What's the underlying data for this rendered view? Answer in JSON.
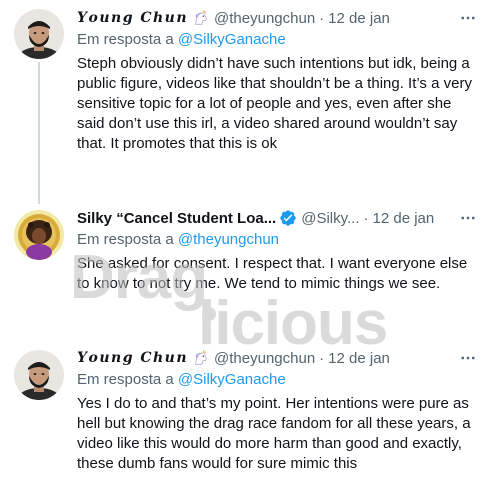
{
  "tweets": [
    {
      "display_name": "𝒀𝒐𝒖𝒏𝒈 𝑪𝒉𝒖𝒏",
      "emoji": "unicorn-emoji",
      "handle": "@theyungchun",
      "separator": "·",
      "time": "12 de jan",
      "reply_prefix": "Em resposta a",
      "reply_mention": "@SilkyGanache",
      "text": "Steph obviously didn’t have such intentions but idk, being a public figure, videos like that shouldn’t be a thing. It’s a very sensitive topic for a lot of people and yes, even after she said don’t use this irl, a video shared around wouldn’t say that. It promotes that this is ok"
    },
    {
      "display_name": "Silky “Cancel Student Loa...",
      "verified": "verified-badge-icon",
      "handle": "@Silky...",
      "separator": "·",
      "time": "12 de jan",
      "reply_prefix": "Em resposta a",
      "reply_mention": "@theyungchun",
      "text": "She asked for consent. I respect that. I want everyone else to know to not try me. We tend to mimic things we see."
    },
    {
      "display_name": "𝒀𝒐𝒖𝒏𝒈 𝑪𝒉𝒖𝒏",
      "emoji": "unicorn-emoji",
      "handle": "@theyungchun",
      "separator": "·",
      "time": "12 de jan",
      "reply_prefix": "Em resposta a",
      "reply_mention": "@SilkyGanache",
      "text": "Yes I do to and that’s my point. Her intentions were pure as hell but knowing the drag race fandom for all these years, a video like this would do more harm than good and exactly, these dumb fans would for sure mimic this"
    }
  ],
  "watermark": "Dragilicious",
  "colors": {
    "link": "#1d9bf0",
    "secondary_text": "#536471",
    "primary_text": "#0f1419",
    "thread_line": "#cfd9de",
    "verified": "#1d9bf0",
    "watermark": "#c8c8c8"
  },
  "icons": {
    "more": "more-horizontal-icon",
    "verified": "verified-badge-icon"
  }
}
